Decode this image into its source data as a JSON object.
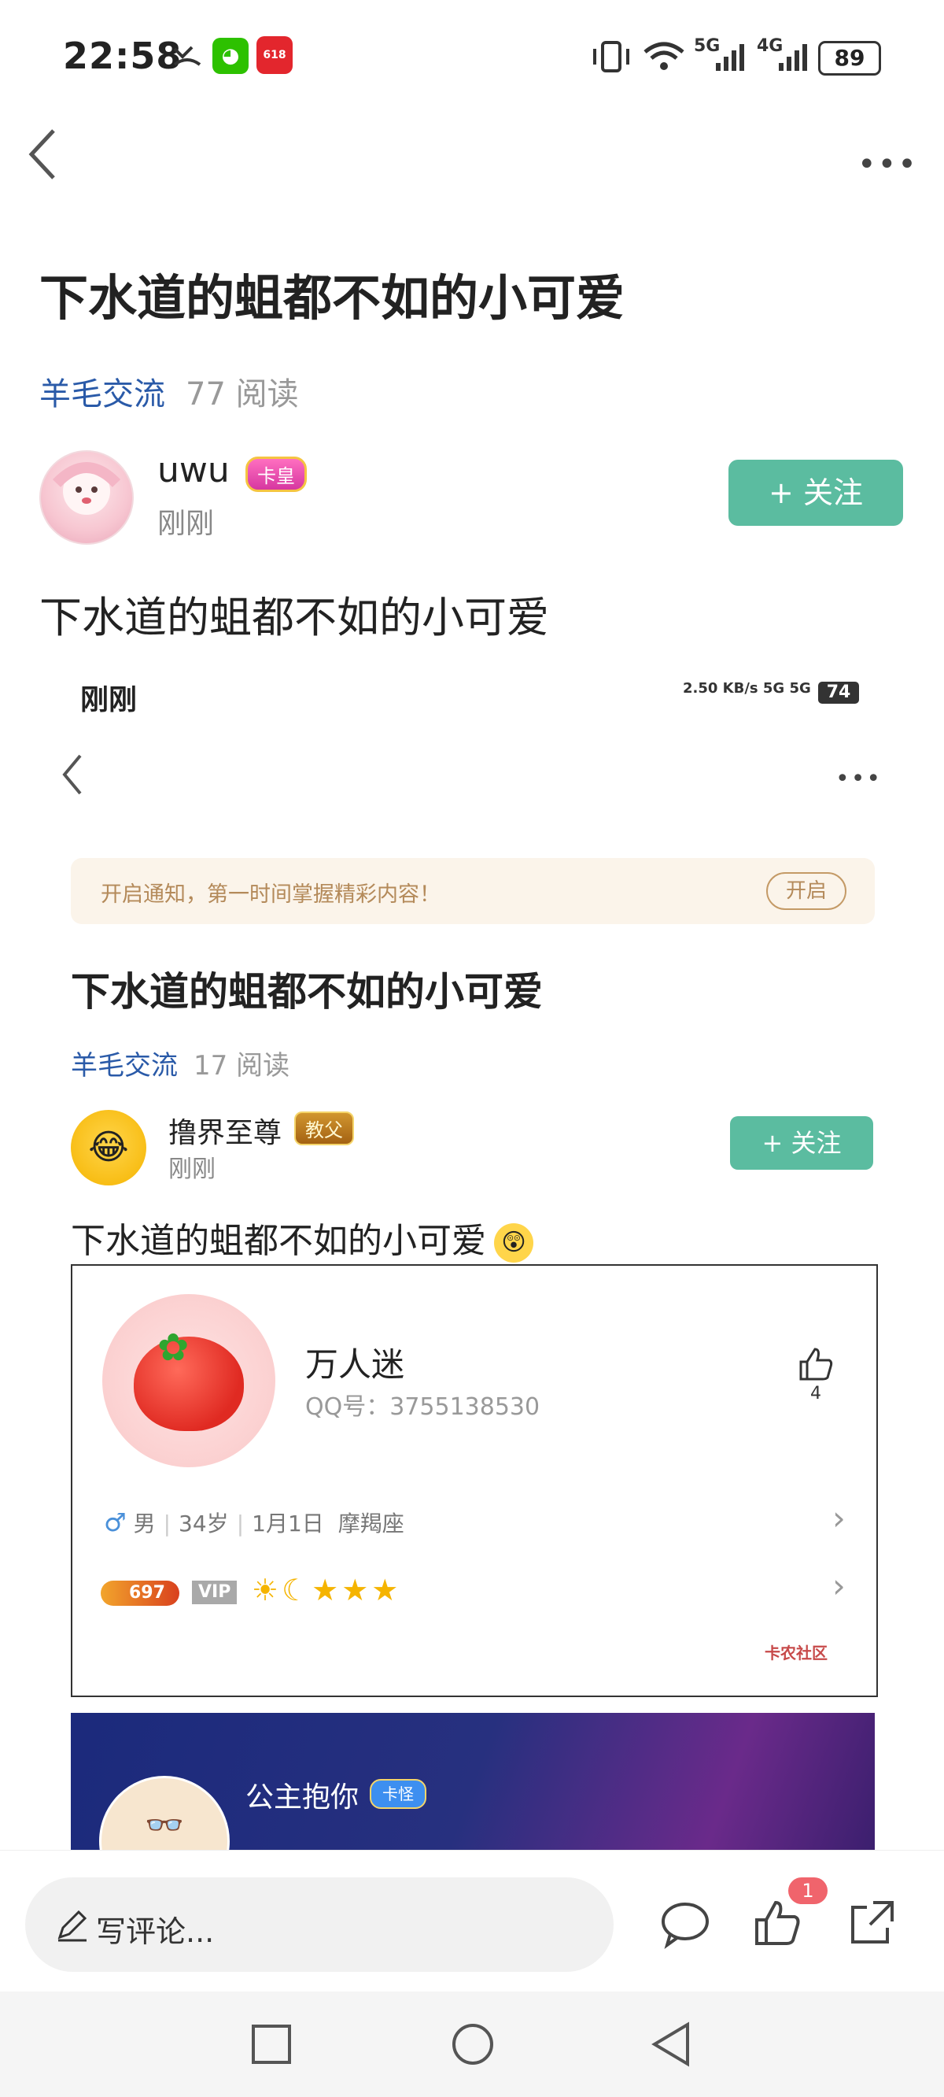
{
  "status_bar": {
    "time": "22:58",
    "net1": "5G",
    "net2": "4G",
    "battery": "89"
  },
  "nav": {
    "more": "•••"
  },
  "post": {
    "title": "下水道的蛆都不如的小可爱",
    "category": "羊毛交流",
    "reads": "77 阅读",
    "author": "uwu",
    "author_badge": "卡皇",
    "time": "刚刚",
    "follow": "+ 关注",
    "body": "下水道的蛆都不如的小可爱"
  },
  "embedded": {
    "time": "刚刚",
    "status": "2.50 KB/s  5G  5G",
    "battery": "74",
    "more": "•••",
    "notice_text": "开启通知，第一时间掌握精彩内容！",
    "notice_btn": "开启",
    "title": "下水道的蛆都不如的小可爱",
    "category": "羊毛交流",
    "reads": "17 阅读",
    "author": "撸界至尊",
    "author_badge": "教父",
    "follow": "+ 关注",
    "body": "下水道的蛆都不如的小可爱",
    "card": {
      "name": "万人迷",
      "qq": "QQ号：3755138530",
      "likes": "4",
      "gender_symbol": "♂",
      "gender": "男",
      "age": "34岁",
      "birthday": "1月1日",
      "zodiac": "摩羯座",
      "coins": "697",
      "vip": "VIP",
      "levels": "☀☾★★★",
      "watermark": "卡农社区"
    },
    "next_post": {
      "name": "公主抱你",
      "badge": "卡怪"
    }
  },
  "bottom_bar": {
    "comment_placeholder": "写评论...",
    "like_badge": "1"
  }
}
